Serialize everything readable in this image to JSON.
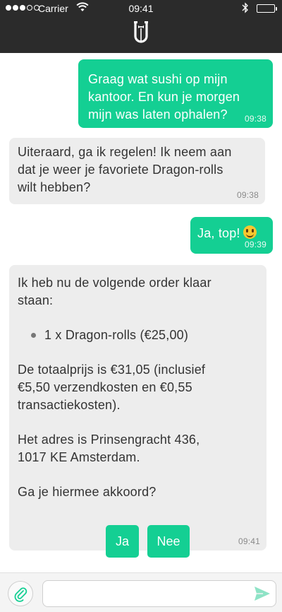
{
  "status_bar": {
    "carrier": "Carrier",
    "time": "09:41"
  },
  "app": {
    "logo_icon": "u-bowtie-logo-icon",
    "accent_color": "#14cf93",
    "header_color": "#2b2b2b"
  },
  "messages": [
    {
      "from": "user",
      "text": "Graag wat sushi op mijn\nkantoor. En kun je morgen\nmijn was laten ophalen?",
      "time": "09:38"
    },
    {
      "from": "assistant",
      "text": "Uiteraard, ga ik regelen! Ik neem aan\ndat je weer je favoriete Dragon-rolls\nwilt hebben?",
      "time": "09:38"
    },
    {
      "from": "user",
      "text": "Ja, top!",
      "emoji": "smiley-emoji",
      "time": "09:39"
    },
    {
      "from": "assistant",
      "intro": "Ik heb nu de volgende order klaar\nstaan:",
      "items": [
        "1 x Dragon-rolls (€25,00)"
      ],
      "total": "De totaalprijs is €31,05 (inclusief\n€5,50 verzendkosten en €0,55\ntransactiekosten).",
      "address": "Het adres is Prinsengracht 436,\n1017 KE Amsterdam.",
      "question": "Ga je hiermee akkoord?",
      "time": "09:41"
    }
  ],
  "quick_replies": [
    "Ja",
    "Nee"
  ],
  "composer": {
    "placeholder": "",
    "attach_icon": "paperclip-icon",
    "send_icon": "send-icon"
  }
}
